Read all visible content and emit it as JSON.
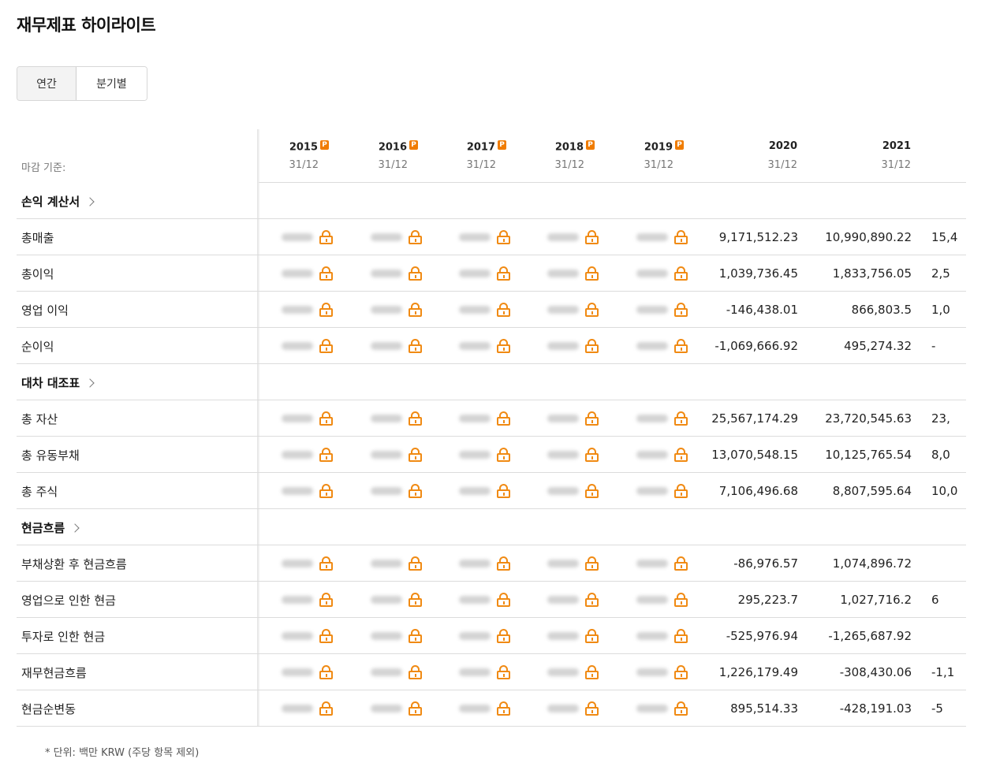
{
  "page": {
    "title": "재무제표 하이라이트"
  },
  "period_toggle": {
    "annual_label": "연간",
    "quarterly_label": "분기별",
    "selected": "연간"
  },
  "table": {
    "basis_label": "마감 기준:",
    "pro_badge_letter": "P",
    "columns": [
      {
        "year": "2015",
        "date": "31/12",
        "locked": true
      },
      {
        "year": "2016",
        "date": "31/12",
        "locked": true
      },
      {
        "year": "2017",
        "date": "31/12",
        "locked": true
      },
      {
        "year": "2018",
        "date": "31/12",
        "locked": true
      },
      {
        "year": "2019",
        "date": "31/12",
        "locked": true
      },
      {
        "year": "2020",
        "date": "31/12",
        "locked": false
      },
      {
        "year": "2021",
        "date": "31/12",
        "locked": false
      }
    ],
    "sections": [
      {
        "label": "손익 계산서",
        "rows": [
          {
            "label": "총매출",
            "v2020": "9,171,512.23",
            "v2021": "10,990,890.22",
            "v2022_partial": "15,4"
          },
          {
            "label": "총이익",
            "v2020": "1,039,736.45",
            "v2021": "1,833,756.05",
            "v2022_partial": "2,5"
          },
          {
            "label": "영업 이익",
            "v2020": "-146,438.01",
            "v2021": "866,803.5",
            "v2022_partial": "1,0"
          },
          {
            "label": "순이익",
            "v2020": "-1,069,666.92",
            "v2021": "495,274.32",
            "v2022_partial": "-"
          }
        ]
      },
      {
        "label": "대차 대조표",
        "rows": [
          {
            "label": "총 자산",
            "v2020": "25,567,174.29",
            "v2021": "23,720,545.63",
            "v2022_partial": "23,"
          },
          {
            "label": "총 유동부채",
            "v2020": "13,070,548.15",
            "v2021": "10,125,765.54",
            "v2022_partial": "8,0"
          },
          {
            "label": "총 주식",
            "v2020": "7,106,496.68",
            "v2021": "8,807,595.64",
            "v2022_partial": "10,0"
          }
        ]
      },
      {
        "label": "현금흐름",
        "rows": [
          {
            "label": "부채상환 후 현금흐름",
            "v2020": "-86,976.57",
            "v2021": "1,074,896.72",
            "v2022_partial": ""
          },
          {
            "label": "영업으로 인한 현금",
            "v2020": "295,223.7",
            "v2021": "1,027,716.2",
            "v2022_partial": "6"
          },
          {
            "label": "투자로 인한 현금",
            "v2020": "-525,976.94",
            "v2021": "-1,265,687.92",
            "v2022_partial": ""
          },
          {
            "label": "재무현금흐름",
            "v2020": "1,226,179.49",
            "v2021": "-308,430.06",
            "v2022_partial": "-1,1"
          },
          {
            "label": "현금순변동",
            "v2020": "895,514.33",
            "v2021": "-428,191.03",
            "v2022_partial": "-5"
          }
        ]
      }
    ]
  },
  "footnote": "* 단위: 백만 KRW (주당 항목 제외)",
  "colors": {
    "accent": "#f08a13",
    "pro_badge": "#f07c00",
    "divider": "#dcdcdc"
  },
  "icons": {
    "lock": "lock-icon",
    "chevron": "chevron-right-icon",
    "pro": "pro-badge-icon"
  }
}
